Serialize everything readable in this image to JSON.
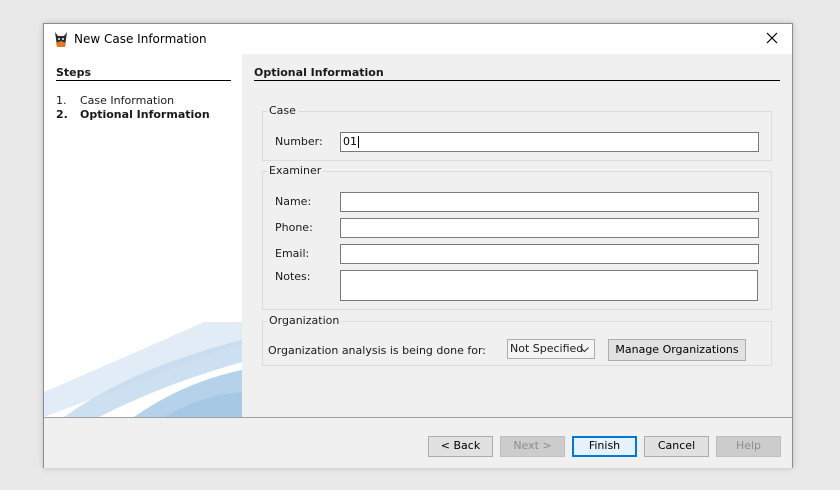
{
  "window": {
    "title": "New Case Information",
    "close_label": "×"
  },
  "steps": {
    "heading": "Steps",
    "items": [
      {
        "number": "1.",
        "label": "Case Information",
        "active": false
      },
      {
        "number": "2.",
        "label": "Optional Information",
        "active": true
      }
    ]
  },
  "main": {
    "heading": "Optional Information",
    "case_group": {
      "title": "Case",
      "number_label": "Number:",
      "number_value": "01"
    },
    "examiner_group": {
      "title": "Examiner",
      "name_label": "Name:",
      "name_value": "",
      "phone_label": "Phone:",
      "phone_value": "",
      "email_label": "Email:",
      "email_value": "",
      "notes_label": "Notes:",
      "notes_value": ""
    },
    "organization_group": {
      "title": "Organization",
      "description": "Organization analysis is being done for:",
      "selected": "Not Specified",
      "manage_label": "Manage Organizations"
    }
  },
  "footer": {
    "back_label": "< Back",
    "next_label": "Next >",
    "finish_label": "Finish",
    "cancel_label": "Cancel",
    "help_label": "Help"
  },
  "colors": {
    "accent": "#0078d7",
    "disabled_button": "#cccccc"
  }
}
